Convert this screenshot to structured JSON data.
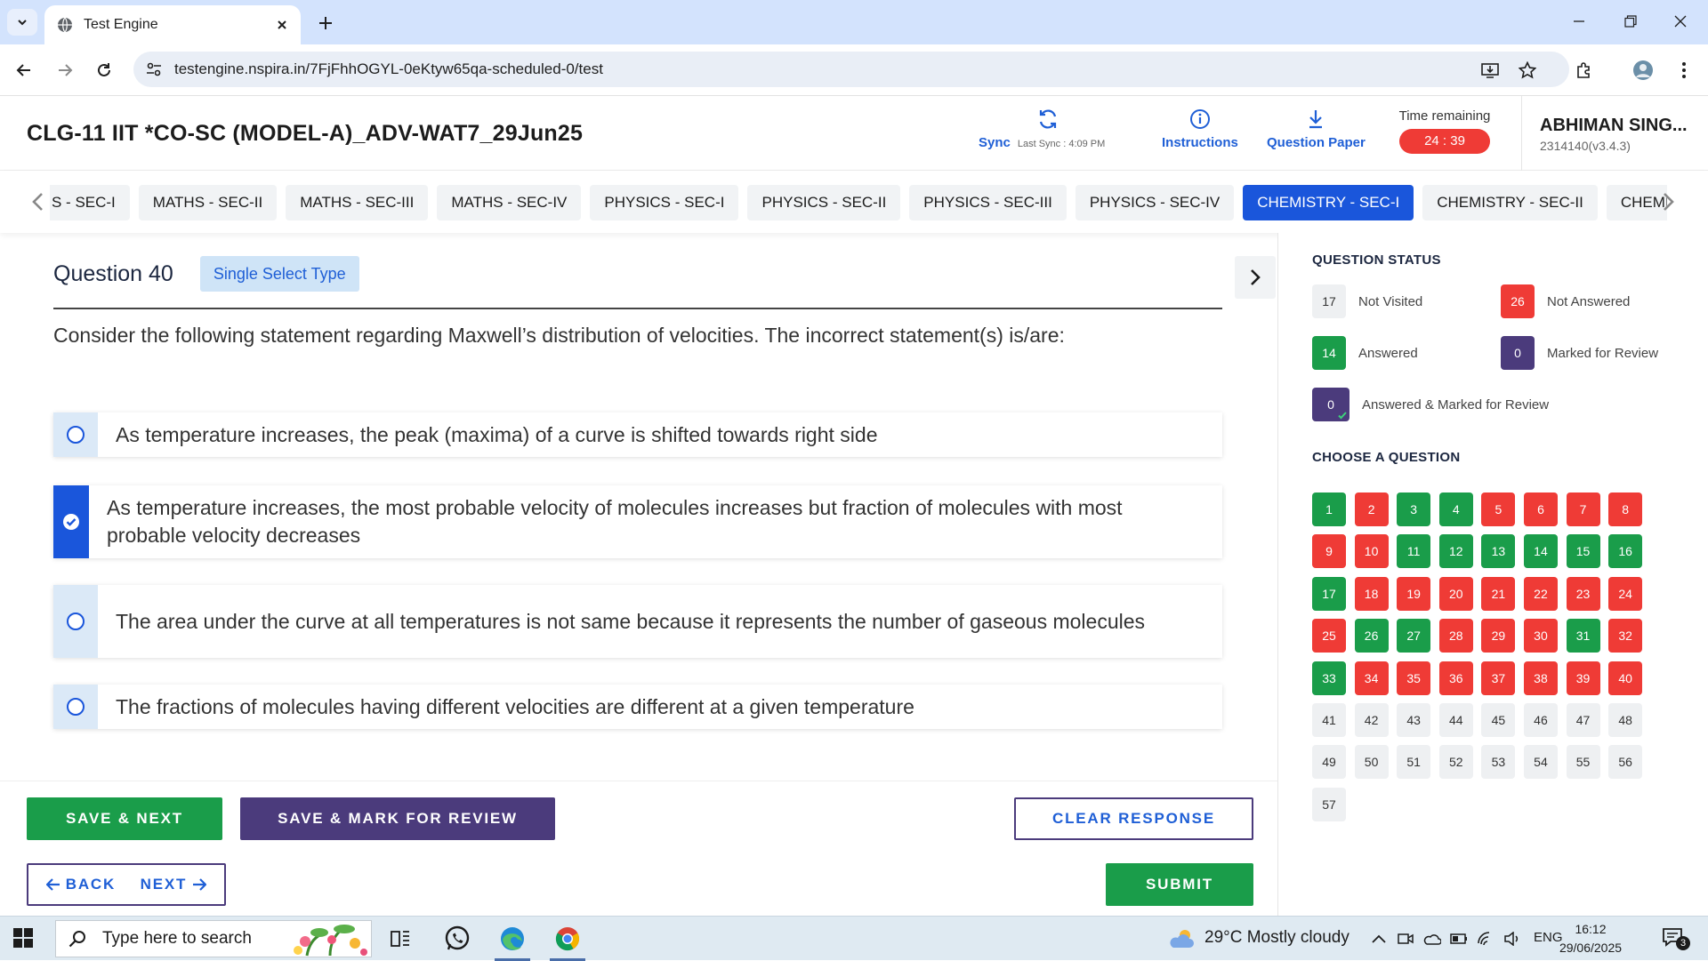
{
  "browser": {
    "tab_title": "Test Engine",
    "url": "testengine.nspira.in/7FjFhhOGYL-0eKtyw65qa-scheduled-0/test"
  },
  "exam": {
    "title": "CLG-11 IIT *CO-SC (MODEL-A)_ADV-WAT7_29Jun25",
    "sync_label": "Sync",
    "last_sync": "Last Sync : 4:09 PM",
    "instructions_label": "Instructions",
    "question_paper_label": "Question Paper",
    "time_remaining_label": "Time remaining",
    "time_remaining_value": "24 : 39",
    "user_name": "ABHIMAN SING...",
    "user_id": "2314140(v3.4.3)"
  },
  "sections": [
    {
      "label": "S - SEC-I",
      "active": false
    },
    {
      "label": "MATHS - SEC-II",
      "active": false
    },
    {
      "label": "MATHS - SEC-III",
      "active": false
    },
    {
      "label": "MATHS - SEC-IV",
      "active": false
    },
    {
      "label": "PHYSICS - SEC-I",
      "active": false
    },
    {
      "label": "PHYSICS - SEC-II",
      "active": false
    },
    {
      "label": "PHYSICS - SEC-III",
      "active": false
    },
    {
      "label": "PHYSICS - SEC-IV",
      "active": false
    },
    {
      "label": "CHEMISTRY - SEC-I",
      "active": true
    },
    {
      "label": "CHEMISTRY - SEC-II",
      "active": false
    },
    {
      "label": "CHEMISTRY - SEC-III",
      "active": false
    }
  ],
  "question": {
    "number_label": "Question 40",
    "type_label": "Single Select Type",
    "text": "Consider the following statement regarding Maxwell’s distribution of velocities. The incorrect statement(s) is/are:",
    "options": [
      {
        "text": "As temperature increases, the peak (maxima) of a curve is shifted towards right side",
        "selected": false
      },
      {
        "text": "As temperature increases, the most probable velocity of molecules increases but fraction of molecules with most probable velocity decreases",
        "selected": true
      },
      {
        "text": "The area under the curve at all temperatures is not same because it represents the number of gaseous molecules",
        "selected": false
      },
      {
        "text": "The fractions of molecules having different velocities are different at a given temperature",
        "selected": false
      }
    ]
  },
  "actions": {
    "save_next": "SAVE & NEXT",
    "save_mark_review": "SAVE & MARK FOR REVIEW",
    "clear_response": "CLEAR RESPONSE",
    "back": "BACK",
    "next": "NEXT",
    "submit": "SUBMIT"
  },
  "status_panel": {
    "title": "QUESTION STATUS",
    "not_visited": {
      "count": "17",
      "label": "Not Visited"
    },
    "not_answered": {
      "count": "26",
      "label": "Not Answered"
    },
    "answered": {
      "count": "14",
      "label": "Answered"
    },
    "marked_review": {
      "count": "0",
      "label": "Marked for Review"
    },
    "answered_marked": {
      "count": "0",
      "label": "Answered & Marked for Review"
    },
    "choose_title": "CHOOSE A QUESTION"
  },
  "question_grid": [
    {
      "n": "1",
      "s": "answered"
    },
    {
      "n": "2",
      "s": "not_answered"
    },
    {
      "n": "3",
      "s": "answered"
    },
    {
      "n": "4",
      "s": "answered"
    },
    {
      "n": "5",
      "s": "not_answered"
    },
    {
      "n": "6",
      "s": "not_answered"
    },
    {
      "n": "7",
      "s": "not_answered"
    },
    {
      "n": "8",
      "s": "not_answered"
    },
    {
      "n": "9",
      "s": "not_answered"
    },
    {
      "n": "10",
      "s": "not_answered"
    },
    {
      "n": "11",
      "s": "answered"
    },
    {
      "n": "12",
      "s": "answered"
    },
    {
      "n": "13",
      "s": "answered"
    },
    {
      "n": "14",
      "s": "answered"
    },
    {
      "n": "15",
      "s": "answered"
    },
    {
      "n": "16",
      "s": "answered"
    },
    {
      "n": "17",
      "s": "answered"
    },
    {
      "n": "18",
      "s": "not_answered"
    },
    {
      "n": "19",
      "s": "not_answered"
    },
    {
      "n": "20",
      "s": "not_answered"
    },
    {
      "n": "21",
      "s": "not_answered"
    },
    {
      "n": "22",
      "s": "not_answered"
    },
    {
      "n": "23",
      "s": "not_answered"
    },
    {
      "n": "24",
      "s": "not_answered"
    },
    {
      "n": "25",
      "s": "not_answered"
    },
    {
      "n": "26",
      "s": "answered"
    },
    {
      "n": "27",
      "s": "answered"
    },
    {
      "n": "28",
      "s": "not_answered"
    },
    {
      "n": "29",
      "s": "not_answered"
    },
    {
      "n": "30",
      "s": "not_answered"
    },
    {
      "n": "31",
      "s": "answered"
    },
    {
      "n": "32",
      "s": "not_answered"
    },
    {
      "n": "33",
      "s": "answered"
    },
    {
      "n": "34",
      "s": "not_answered"
    },
    {
      "n": "35",
      "s": "not_answered"
    },
    {
      "n": "36",
      "s": "not_answered"
    },
    {
      "n": "37",
      "s": "not_answered"
    },
    {
      "n": "38",
      "s": "not_answered"
    },
    {
      "n": "39",
      "s": "not_answered"
    },
    {
      "n": "40",
      "s": "not_answered"
    },
    {
      "n": "41",
      "s": "not_visited"
    },
    {
      "n": "42",
      "s": "not_visited"
    },
    {
      "n": "43",
      "s": "not_visited"
    },
    {
      "n": "44",
      "s": "not_visited"
    },
    {
      "n": "45",
      "s": "not_visited"
    },
    {
      "n": "46",
      "s": "not_visited"
    },
    {
      "n": "47",
      "s": "not_visited"
    },
    {
      "n": "48",
      "s": "not_visited"
    },
    {
      "n": "49",
      "s": "not_visited"
    },
    {
      "n": "50",
      "s": "not_visited"
    },
    {
      "n": "51",
      "s": "not_visited"
    },
    {
      "n": "52",
      "s": "not_visited"
    },
    {
      "n": "53",
      "s": "not_visited"
    },
    {
      "n": "54",
      "s": "not_visited"
    },
    {
      "n": "55",
      "s": "not_visited"
    },
    {
      "n": "56",
      "s": "not_visited"
    },
    {
      "n": "57",
      "s": "not_visited"
    }
  ],
  "colors": {
    "accent_blue": "#1a56db",
    "answered": "#1a9d4a",
    "not_answered": "#ef3b36",
    "marked": "#4b3b7c",
    "not_visited": "#eef0f2"
  },
  "taskbar": {
    "search_placeholder": "Type here to search",
    "weather": "29°C  Mostly cloudy",
    "language": "ENG",
    "time": "16:12",
    "date": "29/06/2025",
    "notification_count": "3"
  }
}
